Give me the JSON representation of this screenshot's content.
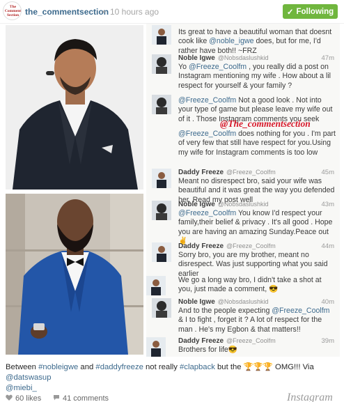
{
  "header": {
    "avatar_text": "The Comment Section",
    "username": "the_commentsection",
    "dot": "•",
    "time_ago": "10 hours ago",
    "follow_label": "Following",
    "follow_check": "✓"
  },
  "comments": [
    {
      "name": "",
      "handle": "",
      "time": "",
      "text": "Its great to have a beautiful woman that doesnt cook like @noble_igwe does, but for me, I'd rather have both!! ~FRZ"
    },
    {
      "name": "Noble Igwe",
      "handle": "@Nobsdaslushkid",
      "time": "47m",
      "text": "Yo @Freeze_Coolfm , you really did a post on Instagram mentioning my wife . How about a lil respect for yourself & your family ?"
    },
    {
      "name": "",
      "handle": "",
      "time": "",
      "text": "@Freeze_Coolfm Not a good look . Not into your type of game but please leave my wife out of it . Those Instagram comments you seek"
    },
    {
      "name": "",
      "handle": "",
      "time": "",
      "text": "@Freeze_Coolfm does nothing for you . I'm part of very few that still have respect for you.Using my wife for Instagram comments is too low"
    },
    {
      "name": "Daddy Freeze",
      "handle": "@Freeze_Coolfm",
      "time": "45m",
      "text": "Meant no disrespect bro, said your wife was beautiful and it was great the way you defended her. Read my post well"
    },
    {
      "name": "Noble Igwe",
      "handle": "@Nobsdaslushkid",
      "time": "43m",
      "text": "@Freeze_Coolfm You know I'd respect your family,their belief & privacy . It's all good . Hope you are having an amazing Sunday.Peace out ✌"
    },
    {
      "name": "Daddy Freeze",
      "handle": "@Freeze_Coolfm",
      "time": "44m",
      "text": "Sorry bro, you are my brother, meant no disrespect. Was just supporting what you said earlier"
    },
    {
      "name": "",
      "handle": "",
      "time": "",
      "text": "We go a long way bro, I didn't take a shot at you, just made a comment, 😎"
    },
    {
      "name": "Noble Igwe",
      "handle": "@Nobsdaslushkid",
      "time": "40m",
      "text": "And to the people expecting @Freeze_Coolfm & I to fight , forget it ? A lot of respect for the man . He's my Egbon & that matters!!"
    },
    {
      "name": "Daddy Freeze",
      "handle": "@Freeze_Coolfm",
      "time": "39m",
      "text": "Brothers for life😎"
    }
  ],
  "watermark": "@The_commentsection",
  "caption": {
    "p1": "Between ",
    "tag1": "#nobleigwe",
    "p2": " and ",
    "tag2": "#daddyfreeze",
    "p3": " not really ",
    "tag3": "#clapback",
    "p4": " but the ",
    "emoji": "🏆🏆🏆",
    "p5": " OMG!!! Via ",
    "tag4": "@datswasup",
    "tag5": "@miebi_"
  },
  "footer": {
    "likes": "60 likes",
    "comments": "41 comments",
    "brand": "Instagram"
  },
  "colors": {
    "link": "#3d6a8d",
    "follow_green": "#70b63e",
    "watermark_red": "#d7182a"
  }
}
